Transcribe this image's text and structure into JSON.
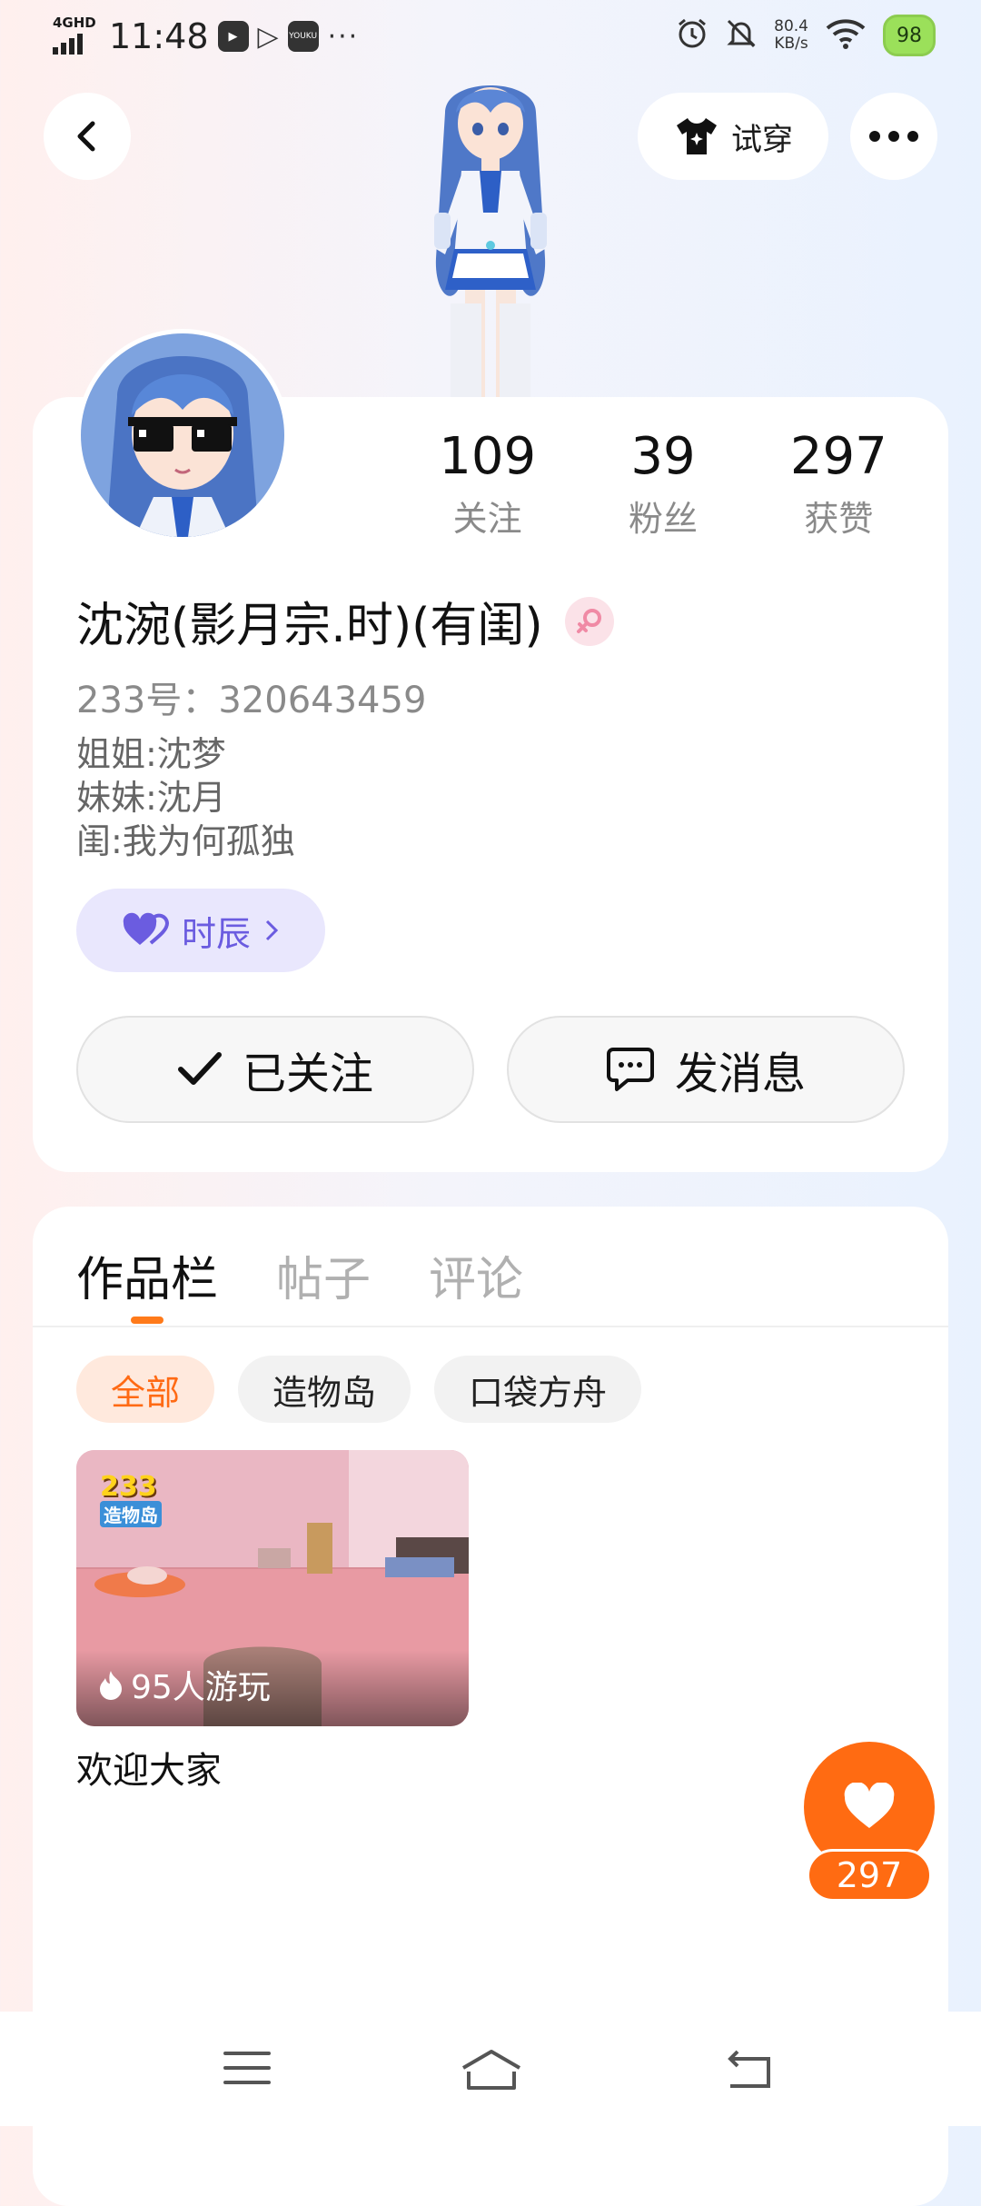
{
  "status_bar": {
    "network": "4GHD",
    "time": "11:48",
    "app_icons": [
      "play-icon",
      "video-icon",
      "youku-icon"
    ],
    "youku_label": "YOUKU",
    "speed_value": "80.4",
    "speed_unit": "KB/s",
    "battery": "98"
  },
  "header": {
    "tryon_label": "试穿"
  },
  "profile": {
    "nickname": "沈涴(影月宗.时)(有闺)",
    "gender": "female",
    "uid": "233号：320643459",
    "bio": [
      "姐姐:沈梦",
      "妹妹:沈月",
      "闺:我为何孤独"
    ],
    "cp_label": "时辰",
    "stats": [
      {
        "value": "109",
        "label": "关注"
      },
      {
        "value": "39",
        "label": "粉丝"
      },
      {
        "value": "297",
        "label": "获赞"
      }
    ],
    "follow_label": "已关注",
    "message_label": "发消息"
  },
  "works": {
    "tabs": [
      "作品栏",
      "帖子",
      "评论"
    ],
    "active_tab": 0,
    "filters": [
      "全部",
      "造物岛",
      "口袋方舟"
    ],
    "active_filter": 0,
    "items": [
      {
        "title": "欢迎大家",
        "plays": "95人游玩",
        "badge_line1": "233",
        "badge_line2": "造物岛"
      }
    ]
  },
  "like": {
    "count": "297"
  },
  "colors": {
    "accent": "#ff6b12",
    "cp_purple": "#6b5ce0",
    "gender_pink": "#f08aa5"
  }
}
